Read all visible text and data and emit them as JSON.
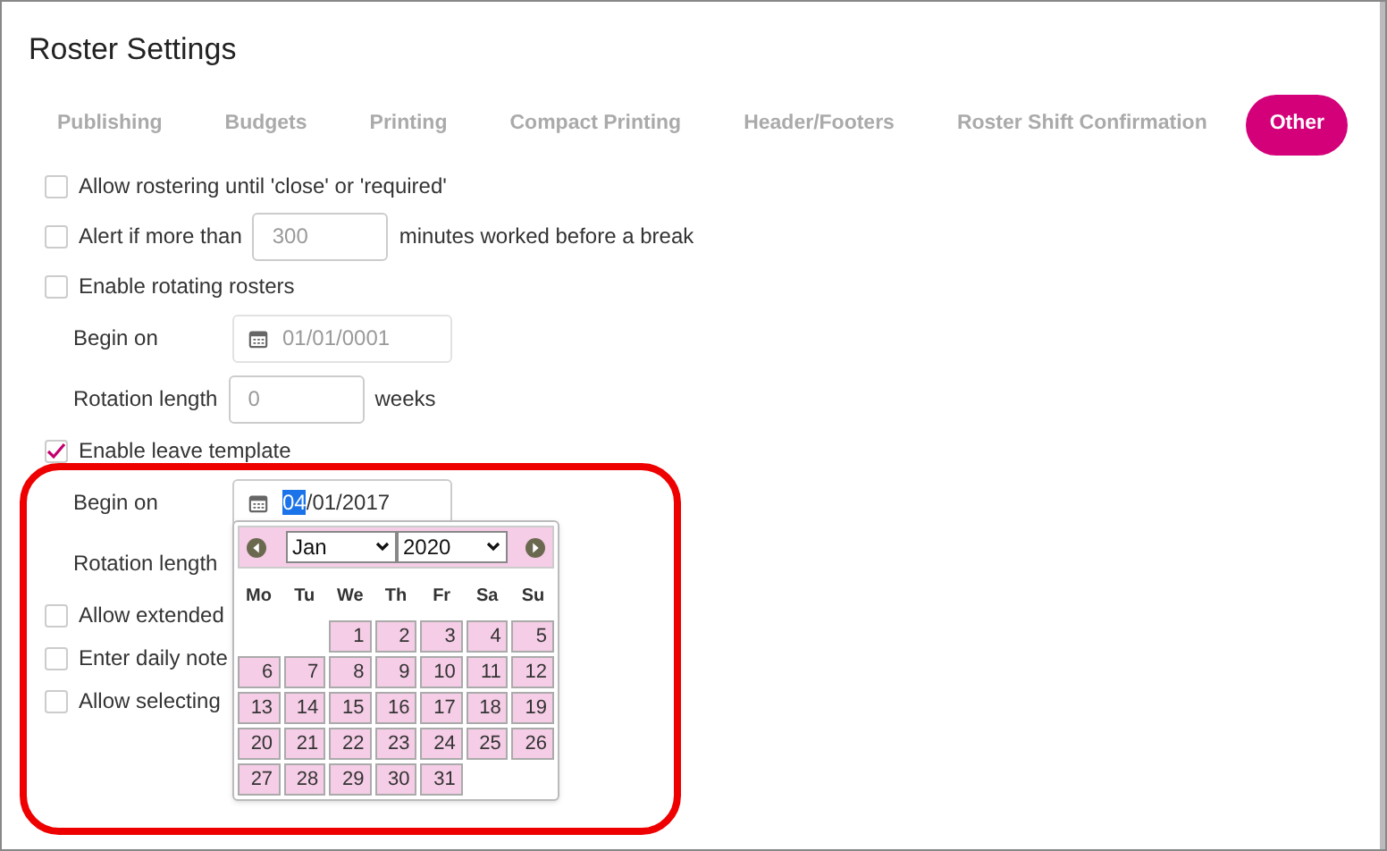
{
  "title": "Roster Settings",
  "tabs": [
    {
      "label": "Publishing",
      "selected": false
    },
    {
      "label": "Budgets",
      "selected": false
    },
    {
      "label": "Printing",
      "selected": false
    },
    {
      "label": "Compact Printing",
      "selected": false
    },
    {
      "label": "Header/Footers",
      "selected": false
    },
    {
      "label": "Roster Shift Confirmation",
      "selected": false
    },
    {
      "label": "Other",
      "selected": true
    }
  ],
  "options": [
    {
      "kind": "checkbox",
      "label": "Allow rostering until 'close' or 'required'",
      "checked": false
    },
    {
      "kind": "checkbox_input",
      "label": "Alert if more than",
      "value": "300",
      "suffix": "minutes worked before a break",
      "checked": false
    },
    {
      "kind": "checkbox",
      "label": "Enable rotating rosters",
      "checked": false
    },
    {
      "kind": "date",
      "label": "Begin on",
      "value_parts": [
        {
          "text": "01/01/0001",
          "selected": false
        }
      ],
      "focused": false
    },
    {
      "kind": "number",
      "label": "Rotation length",
      "value": "0",
      "suffix": "weeks"
    },
    {
      "kind": "checkbox",
      "label": "Enable leave template",
      "checked": true
    },
    {
      "kind": "date",
      "label": "Begin on",
      "value_parts": [
        {
          "text": "04",
          "selected": true
        },
        {
          "text": "/01/2017",
          "selected": false
        }
      ],
      "focused": true
    },
    {
      "kind": "label",
      "label": "Rotation length"
    },
    {
      "kind": "checkbox",
      "label": "Allow extended",
      "checked": false
    },
    {
      "kind": "checkbox",
      "label": "Enter daily note",
      "checked": false
    },
    {
      "kind": "checkbox",
      "label": "Allow selecting",
      "checked": false
    }
  ],
  "date_picker": {
    "month": "Jan",
    "year": "2020",
    "weekdays": [
      "Mo",
      "Tu",
      "We",
      "Th",
      "Fr",
      "Sa",
      "Su"
    ],
    "weeks": [
      [
        {
          "kind": "empty"
        },
        {
          "kind": "empty"
        },
        {
          "kind": "day",
          "label": "1"
        },
        {
          "kind": "day",
          "label": "2"
        },
        {
          "kind": "day",
          "label": "3"
        },
        {
          "kind": "day",
          "label": "4"
        },
        {
          "kind": "day",
          "label": "5"
        }
      ],
      [
        {
          "kind": "day",
          "label": "6"
        },
        {
          "kind": "day",
          "label": "7"
        },
        {
          "kind": "day",
          "label": "8"
        },
        {
          "kind": "day",
          "label": "9"
        },
        {
          "kind": "day",
          "label": "10"
        },
        {
          "kind": "day",
          "label": "11"
        },
        {
          "kind": "day",
          "label": "12"
        }
      ],
      [
        {
          "kind": "day",
          "label": "13"
        },
        {
          "kind": "day",
          "label": "14"
        },
        {
          "kind": "day",
          "label": "15"
        },
        {
          "kind": "day",
          "label": "16"
        },
        {
          "kind": "day",
          "label": "17"
        },
        {
          "kind": "day",
          "label": "18"
        },
        {
          "kind": "day",
          "label": "19"
        }
      ],
      [
        {
          "kind": "day",
          "label": "20"
        },
        {
          "kind": "day",
          "label": "21"
        },
        {
          "kind": "day",
          "label": "22"
        },
        {
          "kind": "day",
          "label": "23"
        },
        {
          "kind": "day",
          "label": "24"
        },
        {
          "kind": "day",
          "label": "25"
        },
        {
          "kind": "day",
          "label": "26"
        }
      ],
      [
        {
          "kind": "day",
          "label": "27"
        },
        {
          "kind": "day",
          "label": "28"
        },
        {
          "kind": "day",
          "label": "29"
        },
        {
          "kind": "day",
          "label": "30"
        },
        {
          "kind": "day",
          "label": "31"
        },
        {
          "kind": "empty"
        },
        {
          "kind": "empty"
        }
      ]
    ]
  }
}
